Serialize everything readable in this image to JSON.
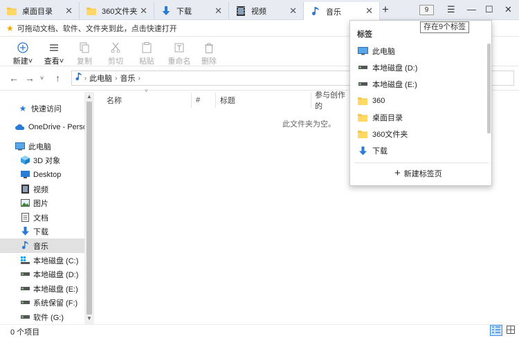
{
  "tabs": [
    {
      "label": "桌面目录",
      "icon": "folder-icon"
    },
    {
      "label": "360文件夹",
      "icon": "folder-icon"
    },
    {
      "label": "下载",
      "icon": "download-icon"
    },
    {
      "label": "视频",
      "icon": "video-icon"
    },
    {
      "label": "音乐",
      "icon": "music-icon"
    }
  ],
  "tab_count": "9",
  "tooltip": "存在9个标签",
  "favbar": {
    "text": "可拖动文档、软件、文件夹到此，点击快速打开"
  },
  "ribbon": {
    "new": "新建",
    "view": "查看",
    "copy": "复制",
    "cut": "剪切",
    "paste": "粘贴",
    "rename": "重命名",
    "delete": "删除"
  },
  "address": {
    "crumbs": [
      "此电脑",
      "音乐"
    ]
  },
  "sidebar": {
    "items": [
      {
        "label": "快速访问",
        "icon": "star-icon"
      },
      {
        "label": "OneDrive - Personal",
        "icon": "cloud-icon"
      },
      {
        "label": "此电脑",
        "icon": "computer-icon"
      },
      {
        "label": "3D 对象",
        "icon": "cube-icon"
      },
      {
        "label": "Desktop",
        "icon": "desktop-icon"
      },
      {
        "label": "视频",
        "icon": "video-icon"
      },
      {
        "label": "图片",
        "icon": "picture-icon"
      },
      {
        "label": "文档",
        "icon": "document-icon"
      },
      {
        "label": "下载",
        "icon": "download-icon"
      },
      {
        "label": "音乐",
        "icon": "music-icon"
      },
      {
        "label": "本地磁盘 (C:)",
        "icon": "drive-icon"
      },
      {
        "label": "本地磁盘 (D:)",
        "icon": "drive-icon"
      },
      {
        "label": "本地磁盘 (E:)",
        "icon": "drive-icon"
      },
      {
        "label": "系统保留 (F:)",
        "icon": "drive-icon"
      },
      {
        "label": "软件 (G:)",
        "icon": "drive-icon"
      }
    ]
  },
  "columns": [
    "名称",
    "#",
    "标题",
    "参与创作的"
  ],
  "empty_message": "此文件夹为空。",
  "status": {
    "items": "0 个项目"
  },
  "popup": {
    "title": "标签",
    "items": [
      {
        "label": "此电脑",
        "icon": "computer-icon"
      },
      {
        "label": "本地磁盘 (D:)",
        "icon": "drive-icon"
      },
      {
        "label": "本地磁盘 (E:)",
        "icon": "drive-icon"
      },
      {
        "label": "360",
        "icon": "folder-icon"
      },
      {
        "label": "桌面目录",
        "icon": "folder-icon"
      },
      {
        "label": "360文件夹",
        "icon": "folder-icon"
      },
      {
        "label": "下载",
        "icon": "download-icon"
      }
    ],
    "new_tab": "新建标签页"
  }
}
